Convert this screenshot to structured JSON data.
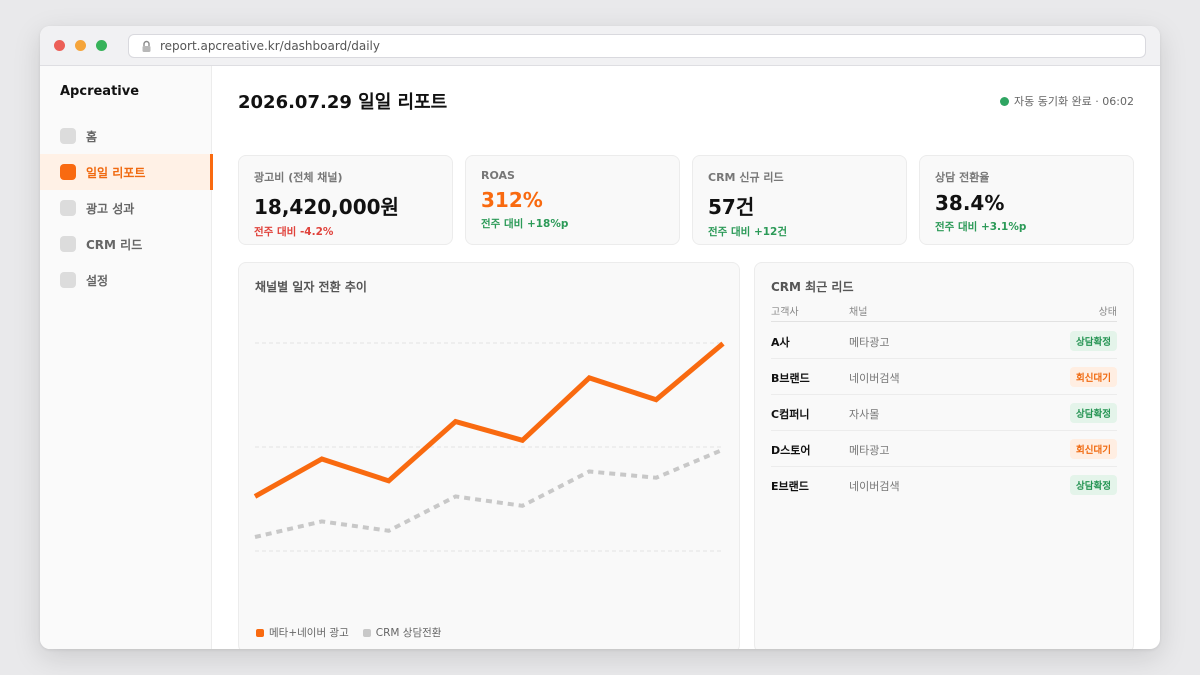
{
  "browser": {
    "url": "report.apcreative.kr/dashboard/daily"
  },
  "sidebar": {
    "brand": "Apcreative",
    "items": [
      {
        "label": "홈",
        "active": false
      },
      {
        "label": "일일 리포트",
        "active": true
      },
      {
        "label": "광고 성과",
        "active": false
      },
      {
        "label": "CRM 리드",
        "active": false
      },
      {
        "label": "설정",
        "active": false
      }
    ]
  },
  "header": {
    "title": "2026.07.29 일일 리포트",
    "sync_status": "자동 동기화 완료 · 06:02"
  },
  "kpis": [
    {
      "label": "광고비 (전체 채널)",
      "value": "18,420,000원",
      "delta": "전주 대비 -4.2%"
    },
    {
      "label": "ROAS",
      "value": "312%",
      "delta": "전주 대비 +18%p"
    },
    {
      "label": "CRM 신규 리드",
      "value": "57건",
      "delta": "전주 대비 +12건"
    },
    {
      "label": "상담 전환율",
      "value": "38.4%",
      "delta": "전주 대비 +3.1%p"
    }
  ],
  "chart_data": {
    "type": "line",
    "title": "채널별 일자 전환 추이",
    "x": [
      1,
      2,
      3,
      4,
      5,
      6,
      7,
      8
    ],
    "ylim": [
      0,
      100
    ],
    "grid": true,
    "legend_position": "bottom-left",
    "series": [
      {
        "name": "메타+네이버 광고",
        "color": "#f96a10",
        "style": "solid",
        "values": [
          38,
          50,
          43,
          62,
          56,
          76,
          69,
          87
        ]
      },
      {
        "name": "CRM 상담전환",
        "color": "#c8c8c8",
        "style": "dotted",
        "values": [
          25,
          30,
          27,
          38,
          35,
          46,
          44,
          53
        ]
      }
    ]
  },
  "crm": {
    "title": "CRM 최근 리드",
    "columns": [
      "고객사",
      "채널",
      "상태"
    ],
    "rows": [
      {
        "company": "A사",
        "channel": "메타광고",
        "status": "상담확정",
        "tone": "green"
      },
      {
        "company": "B브랜드",
        "channel": "네이버검색",
        "status": "회신대기",
        "tone": "orange"
      },
      {
        "company": "C컴퍼니",
        "channel": "자사몰",
        "status": "상담확정",
        "tone": "green"
      },
      {
        "company": "D스토어",
        "channel": "메타광고",
        "status": "회신대기",
        "tone": "orange"
      },
      {
        "company": "E브랜드",
        "channel": "네이버검색",
        "status": "상담확정",
        "tone": "green"
      }
    ]
  },
  "colors": {
    "accent": "#f96a10",
    "positive": "#2c9a58",
    "negative": "#e0423b"
  },
  "icons": {
    "lock": "lock-icon",
    "sync": "status-dot-icon"
  }
}
